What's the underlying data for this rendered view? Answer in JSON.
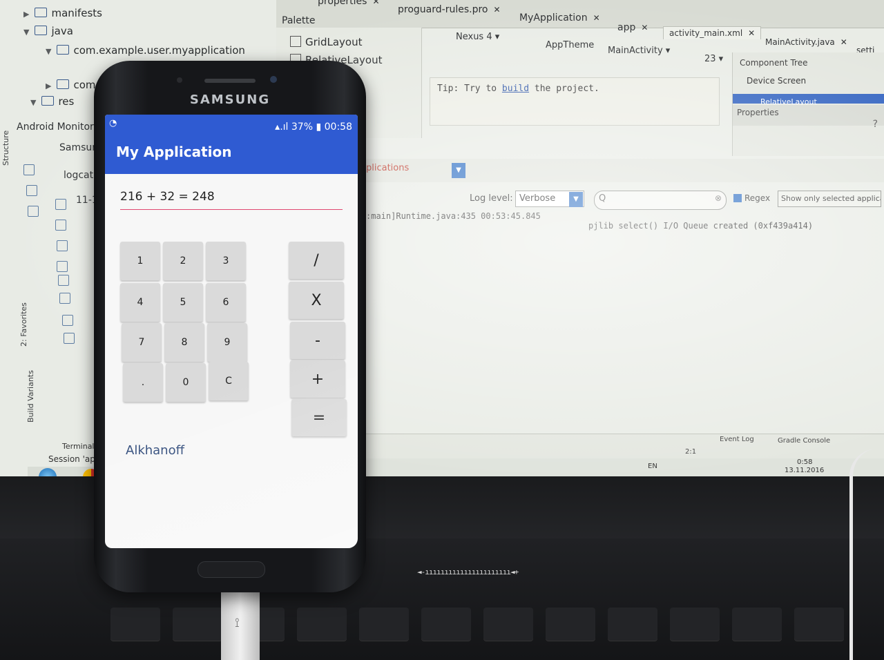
{
  "ide": {
    "project_tree": {
      "items": [
        "manifests",
        "java",
        "com.example.user.myapplication",
        "com",
        "res"
      ]
    },
    "panels": {
      "android_monitor": "Android Monitor",
      "device": "Samsung",
      "logcat": "logcat",
      "log_prefix": "11-1",
      "structure": "Structure",
      "favorites": "2: Favorites",
      "build_variants": "Build Variants",
      "terminal": "Terminal",
      "session": "Session 'app':"
    },
    "tabs": [
      "properties",
      "proguard-rules.pro",
      "MyApplication",
      "app",
      "activity_main.xml",
      "MainActivity.java",
      "setti"
    ],
    "palette": {
      "title": "Palette",
      "items": [
        "GridLayout",
        "RelativeLayout"
      ]
    },
    "toolbar": {
      "device": "Nexus 4",
      "theme": "AppTheme",
      "activity": "MainActivity",
      "api": "23"
    },
    "tip": {
      "prefix": "Tip: Try to ",
      "link": "build",
      "suffix": " the project."
    },
    "component_tree": {
      "title": "Component Tree",
      "device_screen": "Device Screen",
      "relative": "RelativeLayout",
      "properties": "Properties"
    },
    "logcat": {
      "app_selector": "plications",
      "log_level_label": "Log level:",
      "log_level": "Verbose",
      "regex": "Regex",
      "show_only": "Show only selected application",
      "line": ":main]Runtime.java:435 00:53:45.845",
      "line2": "pjlib  select() I/O Queue created (0xf439a414)"
    },
    "status": {
      "event_log": "Event Log",
      "gradle_console": "Gradle Console",
      "position": "2:1",
      "lang": "EN",
      "time": "0:58",
      "date": "13.11.2016"
    }
  },
  "keyboard": {
    "volume": "◄-ıııııııııııııııııııııı◄+"
  },
  "phone": {
    "brand": "SAMSUNG",
    "status": {
      "battery": "37%",
      "time": "00:58"
    },
    "app_title": "My Application",
    "display": "216 + 32 = 248",
    "keys": [
      "1",
      "2",
      "3",
      "4",
      "5",
      "6",
      "7",
      "8",
      "9",
      ".",
      "0",
      "C"
    ],
    "operators": [
      "/",
      "X",
      "-",
      "+",
      "="
    ],
    "author": "Alkhanoff"
  },
  "colors": {
    "app_bar": "#2f5bd2",
    "input_underline": "#e04870",
    "key_bg": "#dadada"
  }
}
